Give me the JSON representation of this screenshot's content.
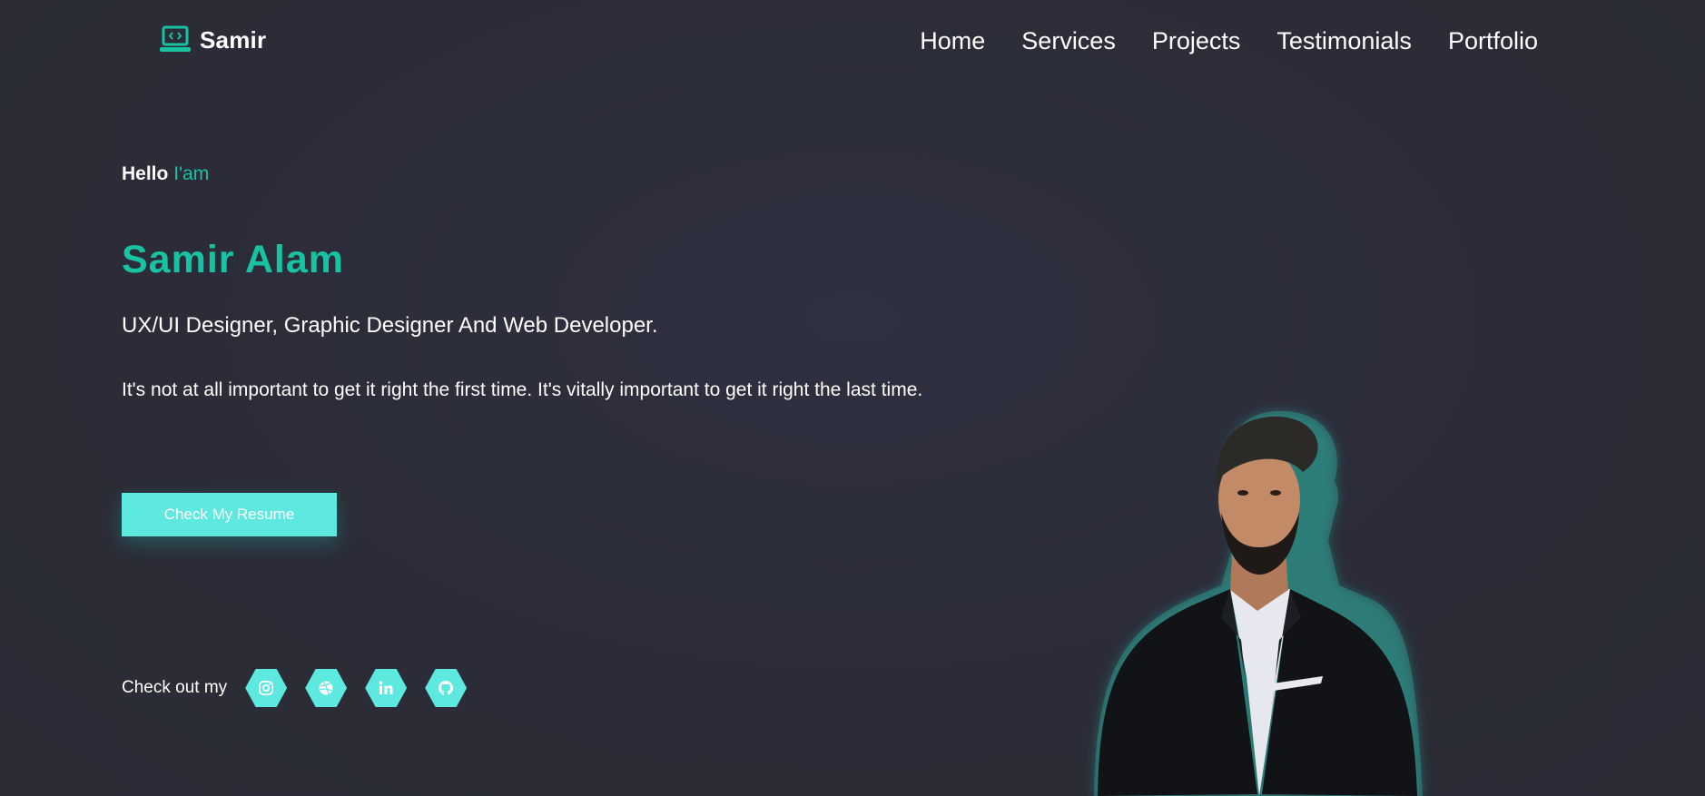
{
  "header": {
    "logo_text": "Samir",
    "logo_icon": "laptop-code-icon",
    "nav": [
      {
        "label": "Home"
      },
      {
        "label": "Services"
      },
      {
        "label": "Projects"
      },
      {
        "label": "Testimonials"
      },
      {
        "label": "Portfolio"
      }
    ]
  },
  "hero": {
    "greeting": "Hello",
    "greeting_accent": "I'am",
    "name": "Samir Alam",
    "roles": "UX/UI Designer, Graphic Designer And Web Developer.",
    "quote": "It's not at all important to get it right the first time. It's vitally important to get it right the last time.",
    "resume_button": "Check My Resume"
  },
  "social": {
    "label": "Check out my",
    "links": [
      {
        "icon": "instagram-icon"
      },
      {
        "icon": "dribbble-icon"
      },
      {
        "icon": "linkedin-icon"
      },
      {
        "icon": "github-icon"
      }
    ]
  },
  "colors": {
    "background": "#2b2c37",
    "accent": "#17c3a2",
    "button": "#5de8e0"
  }
}
